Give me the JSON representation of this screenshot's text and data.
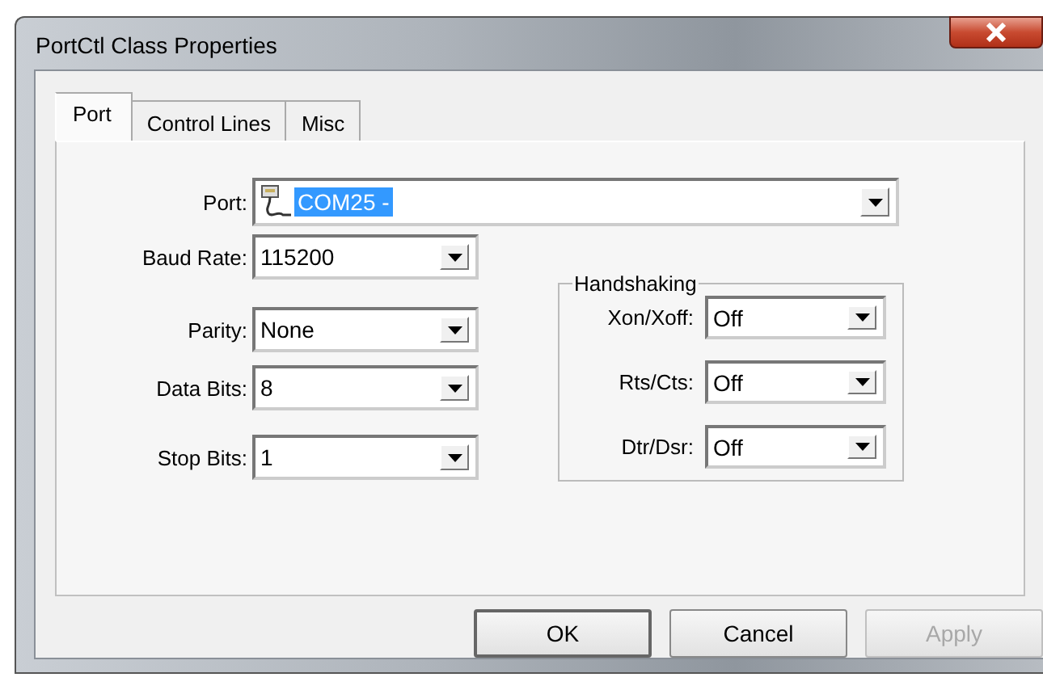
{
  "window": {
    "title": "PortCtl Class Properties"
  },
  "tabs": [
    {
      "label": "Port",
      "selected": true
    },
    {
      "label": "Control Lines",
      "selected": false
    },
    {
      "label": "Misc",
      "selected": false
    }
  ],
  "port": {
    "label": "Port:",
    "value": "COM25 - ",
    "selected": true
  },
  "settings": [
    {
      "label": "Baud Rate:",
      "value": "115200"
    },
    {
      "label": "Parity:",
      "value": "None"
    },
    {
      "label": "Data Bits:",
      "value": "8"
    },
    {
      "label": "Stop Bits:",
      "value": "1"
    }
  ],
  "handshaking": {
    "title": "Handshaking",
    "fields": [
      {
        "label": "Xon/Xoff:",
        "value": "Off"
      },
      {
        "label": "Rts/Cts:",
        "value": "Off"
      },
      {
        "label": "Dtr/Dsr:",
        "value": "Off"
      }
    ]
  },
  "buttons": [
    {
      "label": "OK",
      "disabled": false,
      "default": true
    },
    {
      "label": "Cancel",
      "disabled": false,
      "default": false
    },
    {
      "label": "Apply",
      "disabled": true,
      "default": false
    }
  ]
}
